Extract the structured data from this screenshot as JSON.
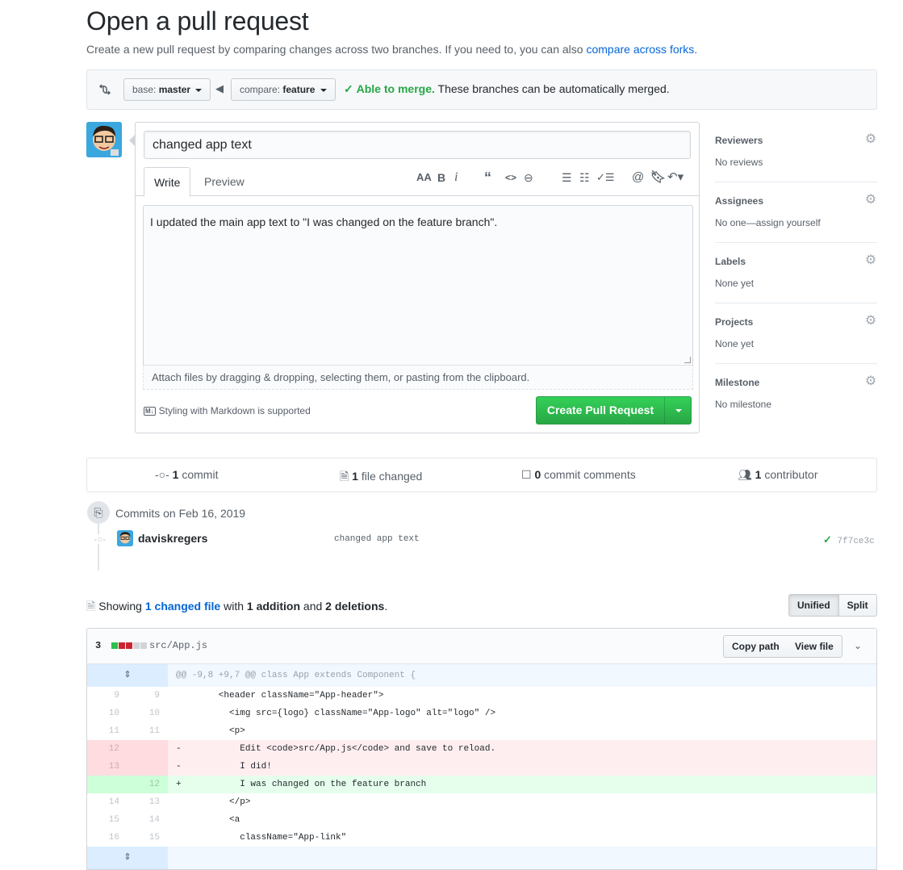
{
  "page": {
    "title": "Open a pull request",
    "subtitle": "Create a new pull request by comparing changes across two branches. If you need to, you can also ",
    "subtitle_link": "compare across forks."
  },
  "compare": {
    "base_prefix": "base: ",
    "base_branch": "master",
    "compare_prefix": "compare: ",
    "compare_branch": "feature",
    "merge_status": "Able to merge.",
    "merge_text": " These branches can be automatically merged."
  },
  "form": {
    "title_value": "changed app text",
    "tab_write": "Write",
    "tab_preview": "Preview",
    "body": "I updated the main app text to \"I was changed on the feature branch\".",
    "attach_text": "Attach files by dragging & dropping, selecting them, or pasting from the clipboard.",
    "markdown_note": "Styling with Markdown is supported",
    "markdown_badge": "M↓",
    "create_button": "Create Pull Request"
  },
  "sidebar": [
    {
      "heading": "Reviewers",
      "value": "No reviews"
    },
    {
      "heading": "Assignees",
      "value": "No one—assign yourself"
    },
    {
      "heading": "Labels",
      "value": "None yet"
    },
    {
      "heading": "Projects",
      "value": "None yet"
    },
    {
      "heading": "Milestone",
      "value": "No milestone"
    }
  ],
  "summary": {
    "commits_count": "1",
    "commits_label": "commit",
    "files_count": "1",
    "files_label": "file changed",
    "comments_count": "0",
    "comments_label": "commit comments",
    "contributors_count": "1",
    "contributors_label": "contributor"
  },
  "commits": {
    "date_header": "Commits on Feb 16, 2019",
    "author": "daviskregers",
    "message": "changed app text",
    "sha": "7f7ce3c"
  },
  "files": {
    "showing_prefix": "Showing ",
    "changed_link": "1 changed file",
    "with_text": " with ",
    "additions": "1 addition",
    "and_text": " and ",
    "deletions": "2 deletions",
    "period": ".",
    "view_unified": "Unified",
    "view_split": "Split"
  },
  "diff": {
    "stat": "3",
    "file_path": "src/App.js",
    "copy_path": "Copy path",
    "view_file": "View file",
    "hunk_header": "@@ -9,8 +9,7 @@ class App extends Component {",
    "rows": [
      {
        "type": "ctx",
        "old": "9",
        "new": "9",
        "code": "        <header className=\"App-header\">"
      },
      {
        "type": "ctx",
        "old": "10",
        "new": "10",
        "code": "          <img src={logo} className=\"App-logo\" alt=\"logo\" />"
      },
      {
        "type": "ctx",
        "old": "11",
        "new": "11",
        "code": "          <p>"
      },
      {
        "type": "del",
        "old": "12",
        "new": "",
        "code": "-           Edit <code>src/App.js</code> and save to reload."
      },
      {
        "type": "del",
        "old": "13",
        "new": "",
        "code": "-           I did!"
      },
      {
        "type": "add",
        "old": "",
        "new": "12",
        "code": "+           I was changed on the feature branch"
      },
      {
        "type": "ctx",
        "old": "14",
        "new": "13",
        "code": "          </p>"
      },
      {
        "type": "ctx",
        "old": "15",
        "new": "14",
        "code": "          <a"
      },
      {
        "type": "ctx",
        "old": "16",
        "new": "15",
        "code": "            className=\"App-link\""
      }
    ]
  },
  "colors": {
    "accent": "#0366d6",
    "green": "#28a745",
    "deletion": "#cb2431"
  }
}
